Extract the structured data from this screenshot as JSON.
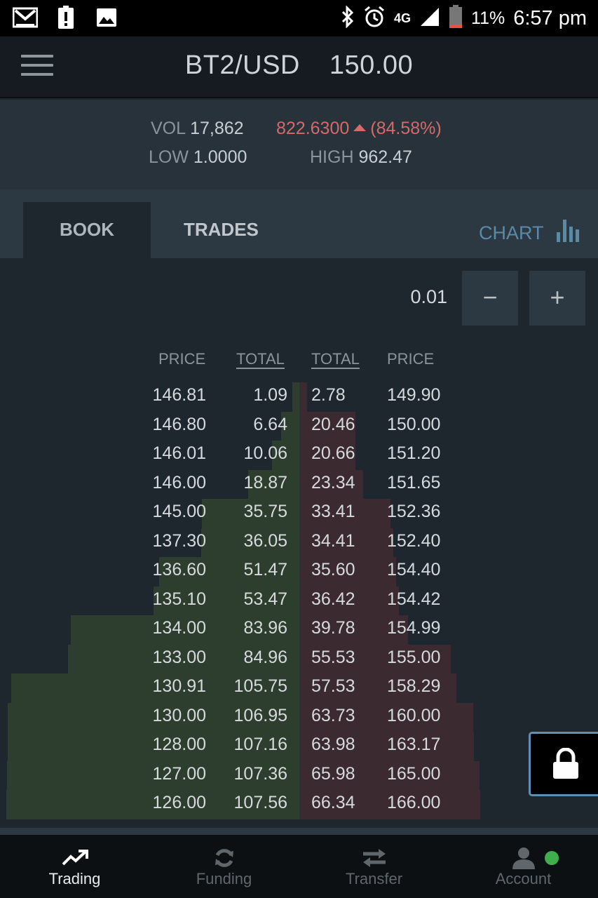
{
  "status_bar": {
    "battery": "11%",
    "time": "6:57 pm",
    "network": "4G"
  },
  "header": {
    "pair": "BT2/USD",
    "price": "150.00"
  },
  "stats": {
    "vol_label": "VOL",
    "vol_value": "17,862",
    "change_value": "822.6300",
    "change_pct": "(84.58%)",
    "low_label": "LOW",
    "low_value": "1.0000",
    "high_label": "HIGH",
    "high_value": "962.47"
  },
  "tabs": {
    "book": "BOOK",
    "trades": "TRADES",
    "chart": "CHART"
  },
  "precision": {
    "value": "0.01",
    "minus": "−",
    "plus": "+"
  },
  "book_headers": {
    "bid_price": "PRICE",
    "bid_total": "TOTAL",
    "ask_total": "TOTAL",
    "ask_price": "PRICE"
  },
  "order_book": [
    {
      "bid_price": "146.81",
      "bid_total": "1.09",
      "ask_total": "2.78",
      "ask_price": "149.90"
    },
    {
      "bid_price": "146.80",
      "bid_total": "6.64",
      "ask_total": "20.46",
      "ask_price": "150.00"
    },
    {
      "bid_price": "146.01",
      "bid_total": "10.06",
      "ask_total": "20.66",
      "ask_price": "151.20"
    },
    {
      "bid_price": "146.00",
      "bid_total": "18.87",
      "ask_total": "23.34",
      "ask_price": "151.65"
    },
    {
      "bid_price": "145.00",
      "bid_total": "35.75",
      "ask_total": "33.41",
      "ask_price": "152.36"
    },
    {
      "bid_price": "137.30",
      "bid_total": "36.05",
      "ask_total": "34.41",
      "ask_price": "152.40"
    },
    {
      "bid_price": "136.60",
      "bid_total": "51.47",
      "ask_total": "35.60",
      "ask_price": "154.40"
    },
    {
      "bid_price": "135.10",
      "bid_total": "53.47",
      "ask_total": "36.42",
      "ask_price": "154.42"
    },
    {
      "bid_price": "134.00",
      "bid_total": "83.96",
      "ask_total": "39.78",
      "ask_price": "154.99"
    },
    {
      "bid_price": "133.00",
      "bid_total": "84.96",
      "ask_total": "55.53",
      "ask_price": "155.00"
    },
    {
      "bid_price": "130.91",
      "bid_total": "105.75",
      "ask_total": "57.53",
      "ask_price": "158.29"
    },
    {
      "bid_price": "130.00",
      "bid_total": "106.95",
      "ask_total": "63.73",
      "ask_price": "160.00"
    },
    {
      "bid_price": "128.00",
      "bid_total": "107.16",
      "ask_total": "63.98",
      "ask_price": "163.17"
    },
    {
      "bid_price": "127.00",
      "bid_total": "107.36",
      "ask_total": "65.98",
      "ask_price": "165.00"
    },
    {
      "bid_price": "126.00",
      "bid_total": "107.56",
      "ask_total": "66.34",
      "ask_price": "166.00"
    }
  ],
  "bottom_nav": {
    "trading": "Trading",
    "funding": "Funding",
    "transfer": "Transfer",
    "account": "Account"
  },
  "colors": {
    "bid_depth": "#2d3d2e",
    "ask_depth": "#3b2a30",
    "change_red": "#d46a6a",
    "chart_blue": "#5a8aa6",
    "online_green": "#3fae4d"
  },
  "icons": {
    "status_left": [
      "gmail-icon",
      "alert-icon",
      "image-icon"
    ],
    "status_right": [
      "bluetooth-icon",
      "alarm-icon",
      "signal-icon",
      "battery-icon"
    ]
  }
}
